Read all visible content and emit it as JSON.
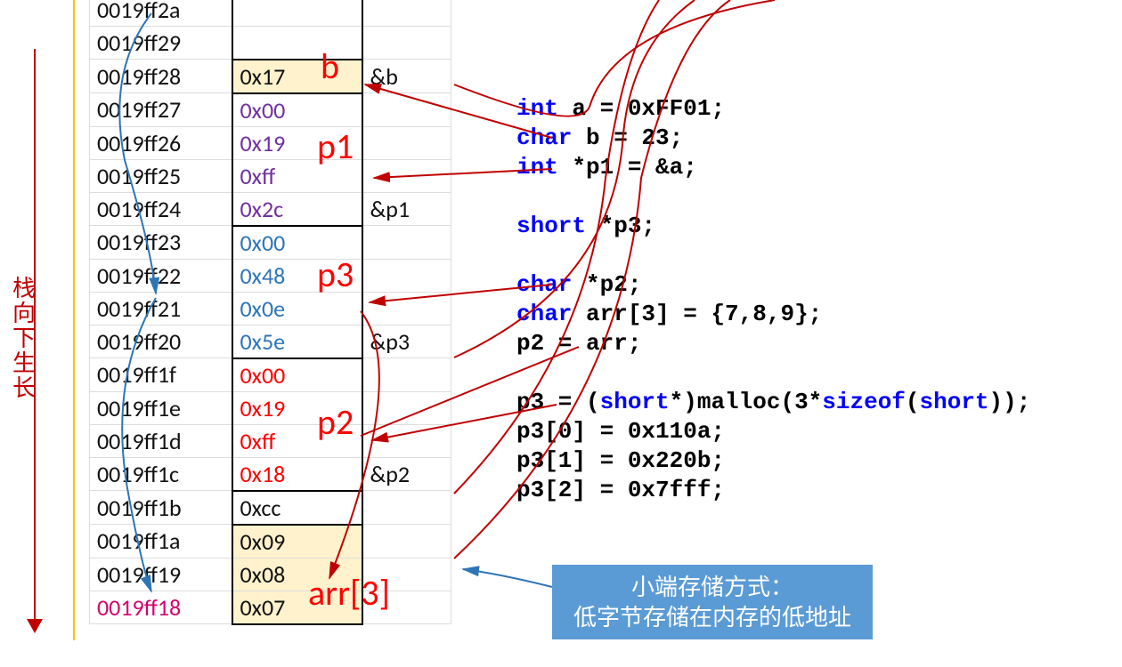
{
  "stack_label": "栈\n向\n下\n生\n长",
  "memory": [
    {
      "addr": "0019ff2a",
      "val": "",
      "name": "",
      "vcls": "",
      "hl": ""
    },
    {
      "addr": "0019ff29",
      "val": "",
      "name": "",
      "vcls": "",
      "hl": ""
    },
    {
      "addr": "0019ff28",
      "val": "0x17",
      "name": "&b",
      "vcls": "c-black",
      "hl": "bg-yellow",
      "box": "tb"
    },
    {
      "addr": "0019ff27",
      "val": "0x00",
      "name": "",
      "vcls": "c-purple",
      "box": "t"
    },
    {
      "addr": "0019ff26",
      "val": "0x19",
      "name": "",
      "vcls": "c-purple"
    },
    {
      "addr": "0019ff25",
      "val": "0xff",
      "name": "",
      "vcls": "c-purple"
    },
    {
      "addr": "0019ff24",
      "val": "0x2c",
      "name": "&p1",
      "vcls": "c-purple",
      "box": "b"
    },
    {
      "addr": "0019ff23",
      "val": "0x00",
      "name": "",
      "vcls": "c-blue",
      "box": "t"
    },
    {
      "addr": "0019ff22",
      "val": "0x48",
      "name": "",
      "vcls": "c-blue"
    },
    {
      "addr": "0019ff21",
      "val": "0x0e",
      "name": "",
      "vcls": "c-blue"
    },
    {
      "addr": "0019ff20",
      "val": "0x5e",
      "name": "&p3",
      "vcls": "c-blue",
      "box": "b"
    },
    {
      "addr": "0019ff1f",
      "val": "0x00",
      "name": "",
      "vcls": "c-red",
      "box": "t"
    },
    {
      "addr": "0019ff1e",
      "val": "0x19",
      "name": "",
      "vcls": "c-red"
    },
    {
      "addr": "0019ff1d",
      "val": "0xff",
      "name": "",
      "vcls": "c-red"
    },
    {
      "addr": "0019ff1c",
      "val": "0x18",
      "name": "&p2",
      "vcls": "c-red",
      "box": "b"
    },
    {
      "addr": "0019ff1b",
      "val": "0xcc",
      "name": "",
      "vcls": "c-black",
      "box": "tb"
    },
    {
      "addr": "0019ff1a",
      "val": "0x09",
      "name": "",
      "vcls": "c-black",
      "hl": "bg-yellow",
      "box": "t"
    },
    {
      "addr": "0019ff19",
      "val": "0x08",
      "name": "",
      "vcls": "c-black",
      "hl": "bg-yellow"
    },
    {
      "addr": "0019ff18",
      "val": "0x07",
      "name": "",
      "vcls": "c-black",
      "hl": "bg-yellow",
      "box": "b",
      "acls": "c-pink"
    }
  ],
  "var_labels": {
    "b": "b",
    "p1": "p1",
    "p3": "p3",
    "p2": "p2",
    "arr": "arr[3]"
  },
  "code": [
    [
      {
        "t": "int",
        "c": "kw"
      },
      {
        "t": " a = 0xFF01;"
      }
    ],
    [
      {
        "t": "char",
        "c": "kw"
      },
      {
        "t": " b = 23;"
      }
    ],
    [
      {
        "t": "int",
        "c": "kw"
      },
      {
        "t": " *p1 = &a;"
      }
    ],
    [
      {
        "t": ""
      }
    ],
    [
      {
        "t": "short",
        "c": "kw"
      },
      {
        "t": " *p3;"
      }
    ],
    [
      {
        "t": ""
      }
    ],
    [
      {
        "t": "char",
        "c": "kw"
      },
      {
        "t": " *p2;"
      }
    ],
    [
      {
        "t": "char",
        "c": "kw"
      },
      {
        "t": " arr[3] = {7,8,9};"
      }
    ],
    [
      {
        "t": "p2 = arr;"
      }
    ],
    [
      {
        "t": ""
      }
    ],
    [
      {
        "t": "p3 = ("
      },
      {
        "t": "short",
        "c": "kw"
      },
      {
        "t": "*)malloc(3*"
      },
      {
        "t": "sizeof",
        "c": "kw"
      },
      {
        "t": "("
      },
      {
        "t": "short",
        "c": "kw"
      },
      {
        "t": "));"
      }
    ],
    [
      {
        "t": "p3[0] = 0x110a;"
      }
    ],
    [
      {
        "t": "p3[1] = 0x220b;"
      }
    ],
    [
      {
        "t": "p3[2] = 0x7fff;"
      }
    ]
  ],
  "endian": {
    "line1": "小端存储方式：",
    "line2": "低字节存储在内存的低地址"
  }
}
